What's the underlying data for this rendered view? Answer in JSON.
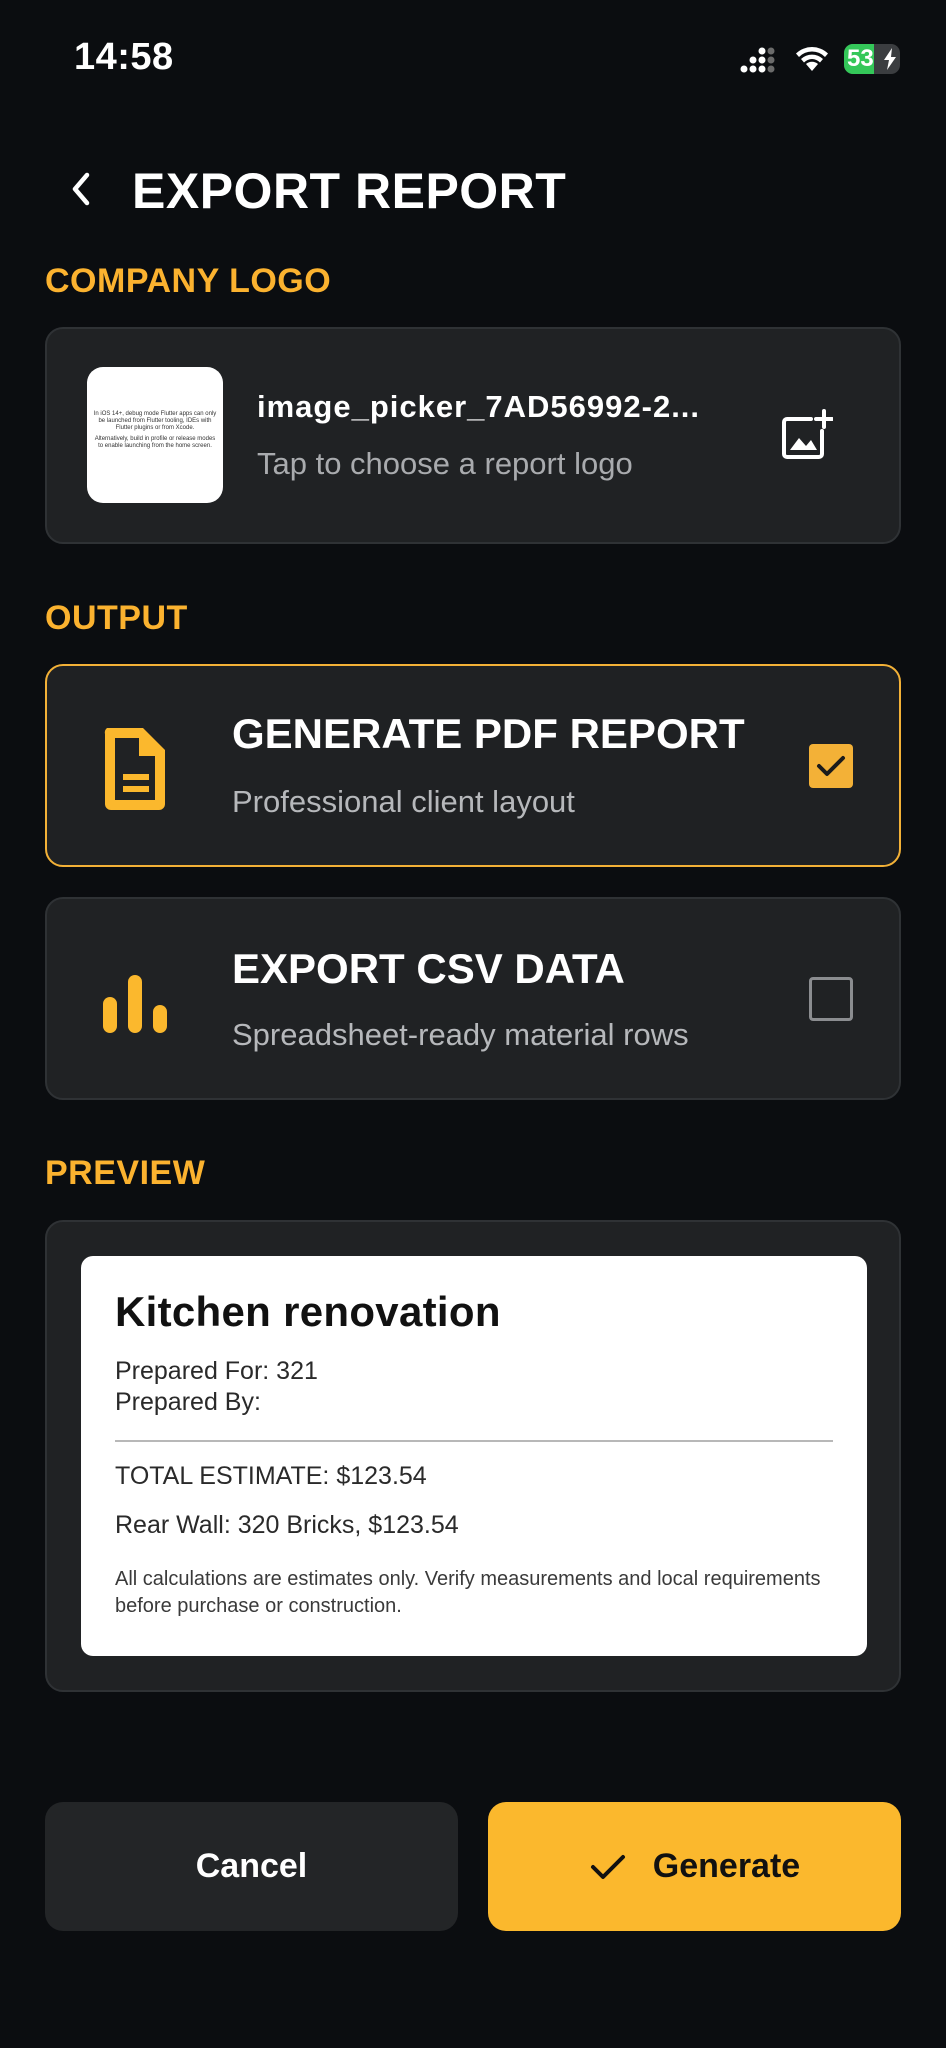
{
  "status_bar": {
    "time": "14:58",
    "battery_level": 53,
    "battery_text": "53"
  },
  "header": {
    "title": "EXPORT REPORT",
    "back_icon": "chevron-left-icon"
  },
  "company_logo": {
    "section_label": "COMPANY LOGO",
    "filename": "image_picker_7AD56992-2...",
    "hint": "Tap to choose a report logo",
    "thumbnail_text": [
      "In iOS 14+, debug mode Flutter apps can only be launched from Flutter tooling, IDEs with Flutter plugins or from Xcode.",
      "Alternatively, build in profile or release modes to enable launching from the home screen."
    ],
    "action_icon": "add-photo-icon"
  },
  "output": {
    "section_label": "OUTPUT",
    "options": [
      {
        "title": "GENERATE PDF REPORT",
        "subtitle": "Professional client layout",
        "checked": true,
        "icon": "document-icon"
      },
      {
        "title": "EXPORT CSV DATA",
        "subtitle": "Spreadsheet-ready material rows",
        "checked": false,
        "icon": "bar-chart-icon"
      }
    ]
  },
  "preview": {
    "section_label": "PREVIEW",
    "title": "Kitchen renovation",
    "prepared_for": "Prepared For: 321",
    "prepared_by": "Prepared By:",
    "total": "TOTAL ESTIMATE: $123.54",
    "item": "Rear Wall: 320 Bricks, $123.54",
    "disclaimer": "All calculations are estimates only. Verify measurements and local requirements before purchase or construction."
  },
  "actions": {
    "cancel_label": "Cancel",
    "generate_label": "Generate"
  },
  "colors": {
    "accent": "#fbb82d",
    "background": "#0b0d10",
    "card": "#202224",
    "battery": "#34c759"
  }
}
